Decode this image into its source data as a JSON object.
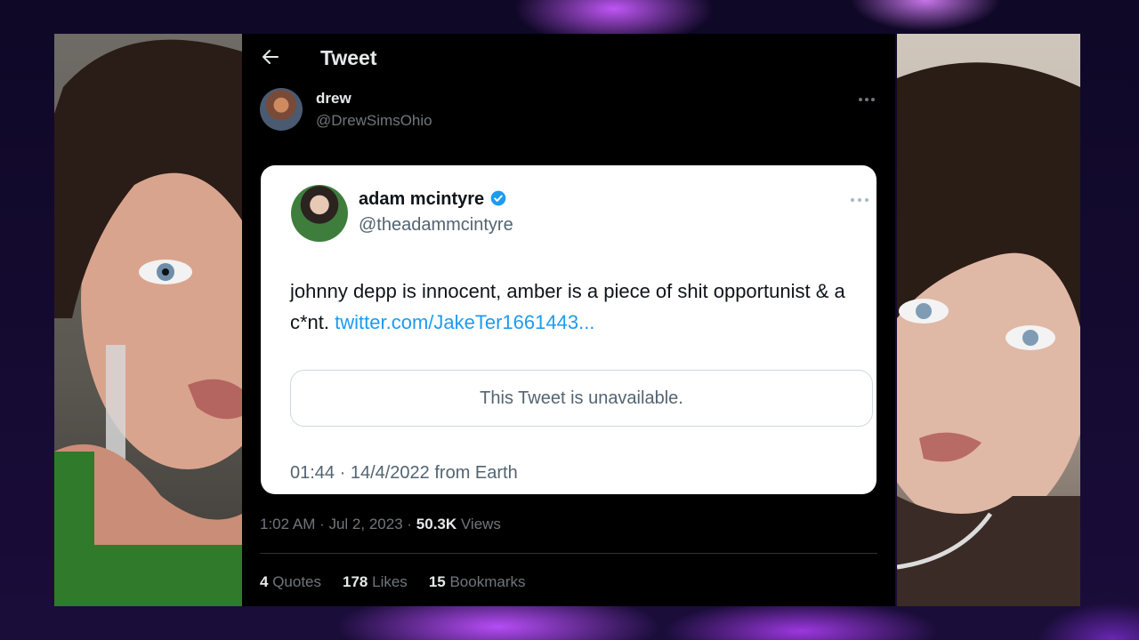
{
  "header": {
    "title": "Tweet"
  },
  "author": {
    "name": "drew",
    "handle": "@DrewSimsOhio"
  },
  "quoted": {
    "name": "adam mcintyre",
    "handle": "@theadammcintyre",
    "text": "johnny depp is innocent, amber is a piece of shit opportunist & a c*nt.",
    "link": "twitter.com/JakeTer1661443...",
    "unavailable": "This Tweet is unavailable.",
    "meta": "01:44 · 14/4/2022 from Earth"
  },
  "tweet_meta": {
    "datetime": "1:02 AM · Jul 2, 2023 ·",
    "views_count": "50.3K",
    "views_label": "Views"
  },
  "stats": [
    {
      "count": "4",
      "label": "Quotes"
    },
    {
      "count": "178",
      "label": "Likes"
    },
    {
      "count": "15",
      "label": "Bookmarks"
    }
  ],
  "colors": {
    "accent": "#1d9bf0",
    "panel": "#000000",
    "muted": "#71767b"
  },
  "icons": [
    "back-arrow-icon",
    "more-icon",
    "verified-badge-icon"
  ]
}
